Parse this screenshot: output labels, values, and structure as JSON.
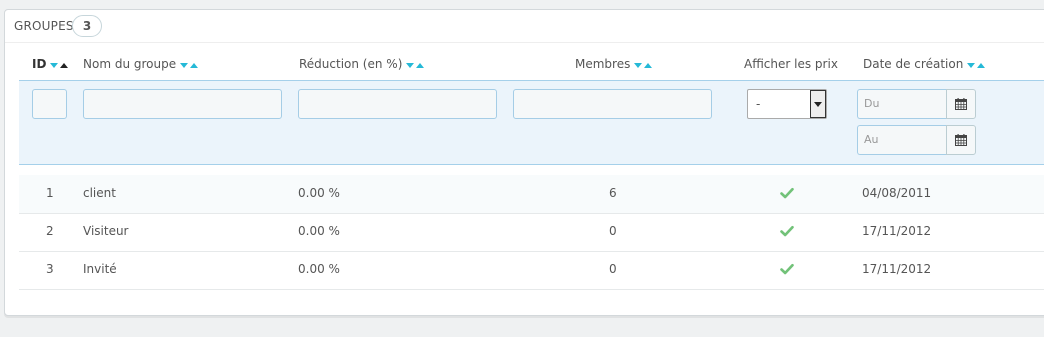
{
  "panel": {
    "title": "GROUPES",
    "count": "3"
  },
  "table": {
    "headers": {
      "id": "ID",
      "name": "Nom du groupe",
      "reduction": "Réduction (en %)",
      "members": "Membres",
      "show_prices": "Afficher les prix",
      "date": "Date de création"
    },
    "filters": {
      "show_prices_value": "-",
      "date_from_placeholder": "Du",
      "date_to_placeholder": "Au"
    },
    "rows": [
      {
        "id": "1",
        "name": "client",
        "reduction": "0.00 %",
        "members": "6",
        "show_prices": true,
        "date": "04/08/2011"
      },
      {
        "id": "2",
        "name": "Visiteur",
        "reduction": "0.00 %",
        "members": "0",
        "show_prices": true,
        "date": "17/11/2012"
      },
      {
        "id": "3",
        "name": "Invité",
        "reduction": "0.00 %",
        "members": "0",
        "show_prices": true,
        "date": "17/11/2012"
      }
    ]
  },
  "colors": {
    "accent": "#25b9d7",
    "check": "#72c279",
    "filter_bg": "#ebf4fb"
  },
  "icons": {
    "sort_desc": "caret-down-icon",
    "sort_asc": "caret-up-icon",
    "calendar": "calendar-icon",
    "check": "check-icon"
  }
}
